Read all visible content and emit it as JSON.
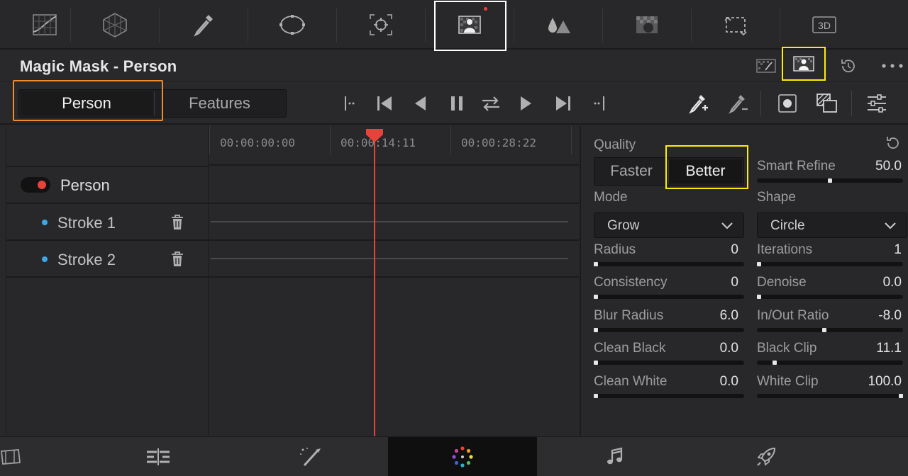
{
  "palette_bar": {
    "items": [
      {
        "icon": "curves-icon"
      },
      {
        "icon": "color-warper-icon"
      },
      {
        "icon": "qualifier-icon"
      },
      {
        "icon": "window-icon"
      },
      {
        "icon": "tracker-icon"
      },
      {
        "icon": "magic-mask-icon",
        "selected": true,
        "badge_color": "#e8423a"
      },
      {
        "icon": "blur-icon"
      },
      {
        "icon": "key-icon"
      },
      {
        "icon": "sizing-icon"
      },
      {
        "icon": "3d-icon",
        "label": "3D"
      }
    ]
  },
  "panel": {
    "title": "Magic Mask - Person",
    "header_icons": [
      "object-mask-icon",
      "person-mask-icon",
      "reset-icon",
      "more-options-icon"
    ]
  },
  "mode_toggle": {
    "options": [
      "Person",
      "Features"
    ],
    "selected": "Person"
  },
  "transport": {
    "icons": [
      "jump-to-in-icon",
      "go-to-start-icon",
      "track-reverse-icon",
      "pause-icon",
      "track-both-icon",
      "track-forward-icon",
      "go-to-end-icon",
      "jump-to-out-icon"
    ]
  },
  "tools": {
    "icons": [
      "add-stroke-icon",
      "remove-stroke-icon",
      "show-overlay-icon",
      "mask-toggle-icon",
      "settings-icon"
    ]
  },
  "track_list": {
    "person": {
      "label": "Person",
      "enabled": true,
      "color": "#e8423a"
    },
    "strokes": [
      {
        "label": "Stroke 1",
        "color": "#3fa7e6"
      },
      {
        "label": "Stroke 2",
        "color": "#3fa7e6"
      }
    ]
  },
  "timeline": {
    "timecodes": [
      "00:00:00:00",
      "00:00:14:11",
      "00:00:28:22"
    ],
    "playhead_color": "#e8423a"
  },
  "inspector": {
    "quality": {
      "label": "Quality",
      "options": [
        "Faster",
        "Better"
      ],
      "selected": "Better"
    },
    "smart_refine": {
      "label": "Smart Refine",
      "value": "50.0",
      "fraction": 0.5
    },
    "mode": {
      "label": "Mode",
      "value": "Grow"
    },
    "shape": {
      "label": "Shape",
      "value": "Circle"
    },
    "params_left": [
      {
        "label": "Radius",
        "value": "0",
        "fraction": 0.0
      },
      {
        "label": "Consistency",
        "value": "0",
        "fraction": 0.0
      },
      {
        "label": "Blur Radius",
        "value": "6.0",
        "fraction": 0.0
      },
      {
        "label": "Clean Black",
        "value": "0.0",
        "fraction": 0.0
      },
      {
        "label": "Clean White",
        "value": "0.0",
        "fraction": 0.0
      }
    ],
    "params_right": [
      {
        "label": "Iterations",
        "value": "1",
        "fraction": 0.0
      },
      {
        "label": "Denoise",
        "value": "0.0",
        "fraction": 0.0
      },
      {
        "label": "In/Out Ratio",
        "value": "-8.0",
        "fraction": 0.46
      },
      {
        "label": "Black Clip",
        "value": "11.1",
        "fraction": 0.11
      },
      {
        "label": "White Clip",
        "value": "100.0",
        "fraction": 1.0
      }
    ]
  },
  "page_nav": {
    "items": [
      {
        "icon": "media-page-icon"
      },
      {
        "icon": "edit-page-icon"
      },
      {
        "icon": "fusion-page-icon"
      },
      {
        "icon": "color-page-icon",
        "active": true
      },
      {
        "icon": "fairlight-page-icon"
      },
      {
        "icon": "deliver-page-icon"
      }
    ]
  },
  "colors": {
    "highlight_white": "#ffffff",
    "highlight_yellow": "#ffee00",
    "highlight_orange": "#f28a2e",
    "accent_red": "#e8423a",
    "accent_blue": "#3fa7e6"
  }
}
